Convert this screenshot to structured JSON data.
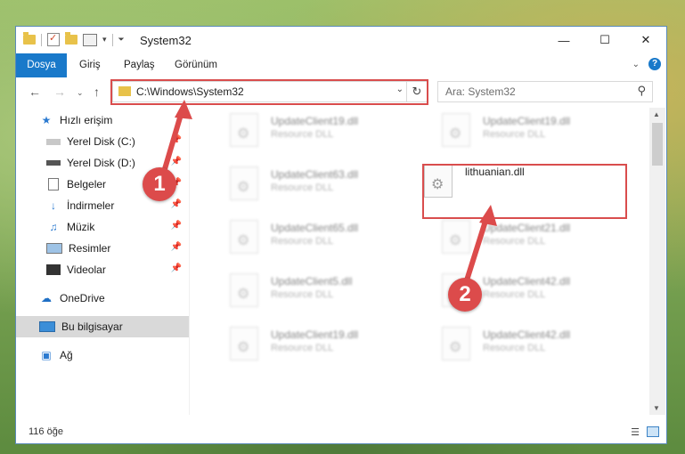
{
  "window": {
    "title": "System32"
  },
  "ribbon": {
    "tabs": [
      "Dosya",
      "Giriş",
      "Paylaş",
      "Görünüm"
    ]
  },
  "address": {
    "path": "C:\\Windows\\System32"
  },
  "search": {
    "placeholder": "Ara: System32"
  },
  "sidebar": {
    "items": [
      {
        "label": "Hızlı erişim"
      },
      {
        "label": "Yerel Disk (C:)"
      },
      {
        "label": "Yerel Disk (D:)"
      },
      {
        "label": "Belgeler"
      },
      {
        "label": "İndirmeler"
      },
      {
        "label": "Müzik"
      },
      {
        "label": "Resimler"
      },
      {
        "label": "Videolar"
      },
      {
        "label": "OneDrive"
      },
      {
        "label": "Bu bilgisayar"
      },
      {
        "label": "Ağ"
      }
    ]
  },
  "files": [
    {
      "name": "UpdateClient19.dll",
      "desc": "Resource DLL"
    },
    {
      "name": "UpdateClient19.dll",
      "desc": "Resource DLL"
    },
    {
      "name": "UpdateClient63.dll",
      "desc": "Resource DLL"
    },
    {
      "name": "lithuanian.dll",
      "desc": ""
    },
    {
      "name": "UpdateClient65.dll",
      "desc": "Resource DLL"
    },
    {
      "name": "UpdateClient21.dll",
      "desc": "Resource DLL"
    },
    {
      "name": "UpdateClient5.dll",
      "desc": "Resource DLL"
    },
    {
      "name": "UpdateClient42.dll",
      "desc": "Resource DLL"
    },
    {
      "name": "UpdateClient19.dll",
      "desc": "Resource DLL"
    },
    {
      "name": "UpdateClient42.dll",
      "desc": "Resource DLL"
    }
  ],
  "status": {
    "count": "116 öğe"
  },
  "annotations": {
    "step1": "1",
    "step2": "2"
  },
  "colors": {
    "accent": "#1979ca",
    "annotation": "#dc4b4b"
  }
}
